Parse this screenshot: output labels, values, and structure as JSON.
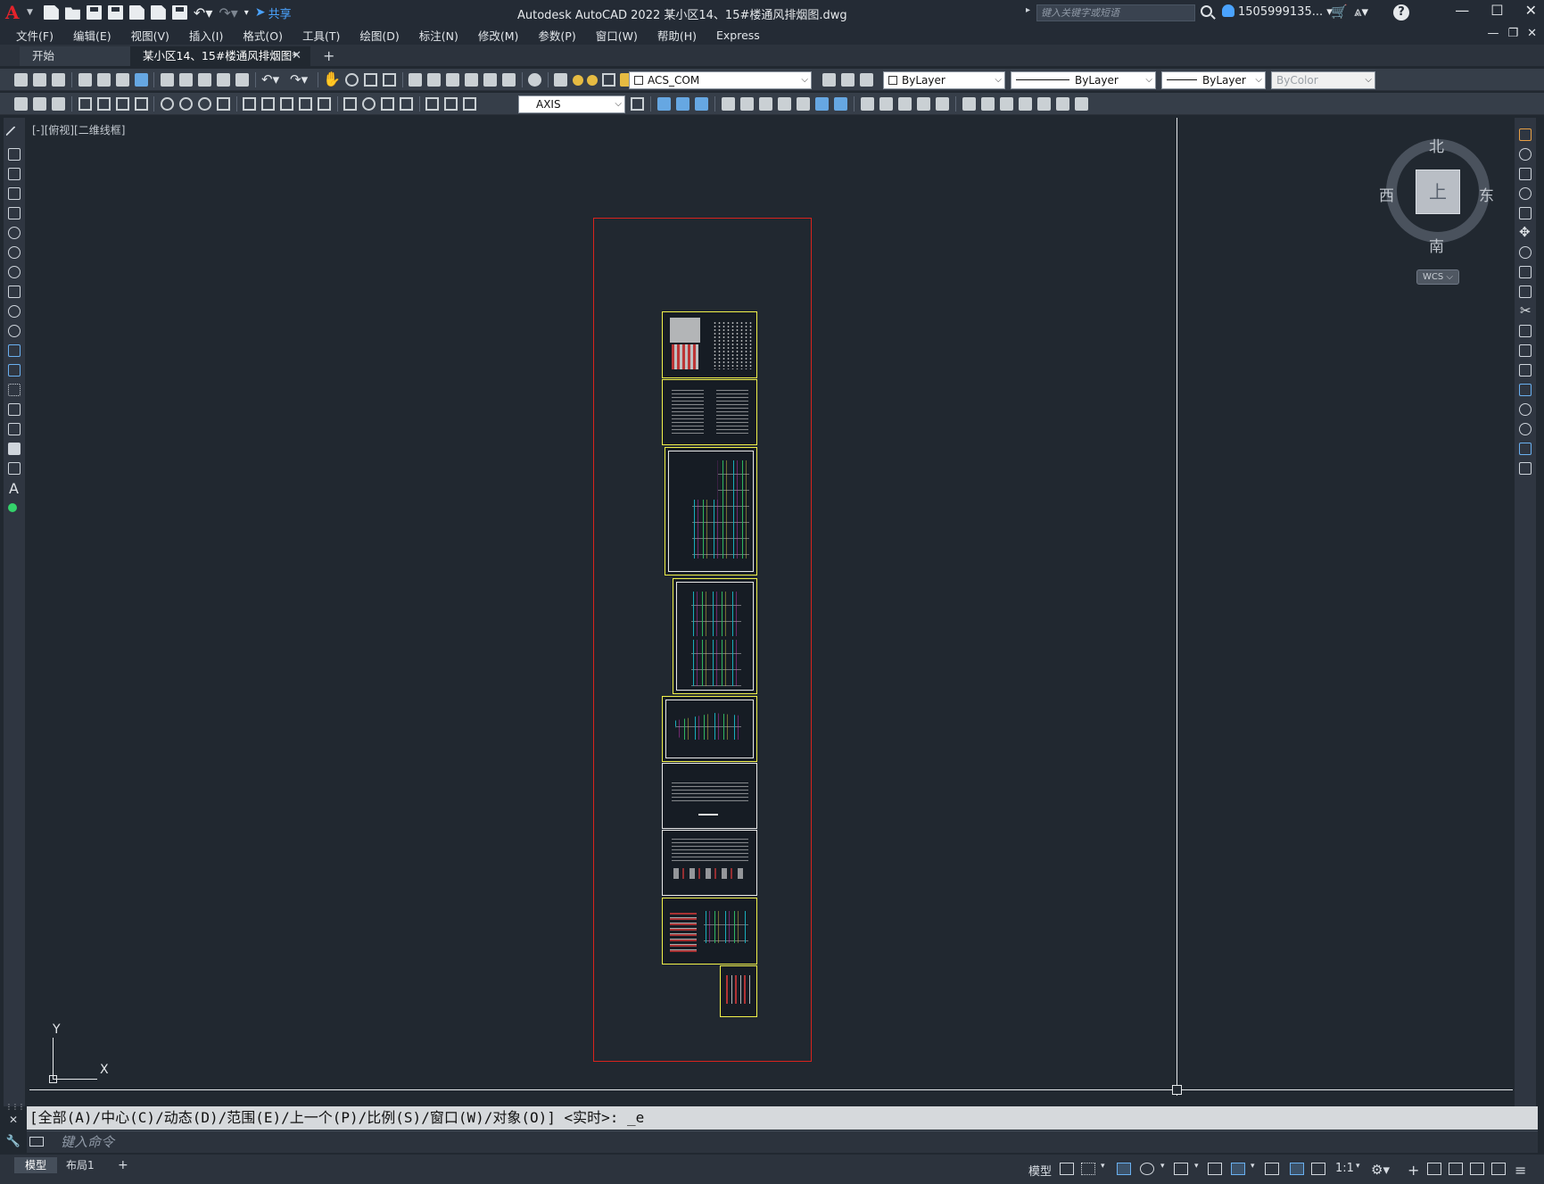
{
  "app": {
    "logo": "A",
    "window_title": "Autodesk AutoCAD 2022    某小区14、15#楼通风排烟图.dwg",
    "search_placeholder": "键入关键字或短语",
    "user": "1505999135...",
    "share_label": "共享"
  },
  "menu": [
    "文件(F)",
    "编辑(E)",
    "视图(V)",
    "插入(I)",
    "格式(O)",
    "工具(T)",
    "绘图(D)",
    "标注(N)",
    "修改(M)",
    "参数(P)",
    "窗口(W)",
    "帮助(H)",
    "Express"
  ],
  "tabs": {
    "start": "开始",
    "active": "某小区14、15#楼通风排烟图*"
  },
  "toolbar": {
    "layer": "ACS_COM",
    "color": "ByLayer",
    "linetype": "ByLayer",
    "lineweight": "ByLayer",
    "plotstyle": "ByColor",
    "dimstyle": "AXIS"
  },
  "viewport": {
    "label": "[-][俯视][二维线框]"
  },
  "viewcube": {
    "north": "北",
    "south": "南",
    "east": "东",
    "west": "西",
    "face": "上",
    "wcs": "WCS"
  },
  "ucs": {
    "x": "X",
    "y": "Y"
  },
  "command": {
    "history": "[全部(A)/中心(C)/动态(D)/范围(E)/上一个(P)/比例(S)/窗口(W)/对象(O)] <实时>: _e",
    "placeholder": "键入命令"
  },
  "status": {
    "model_tab": "模型",
    "layout_tab": "布局1",
    "model_space": "模型",
    "scale": "1:1"
  },
  "colors": {
    "background": "#212830",
    "frame_red": "#d8231d",
    "sheet_yellow": "#f2f24a",
    "accent_blue": "#4aa3ff"
  }
}
